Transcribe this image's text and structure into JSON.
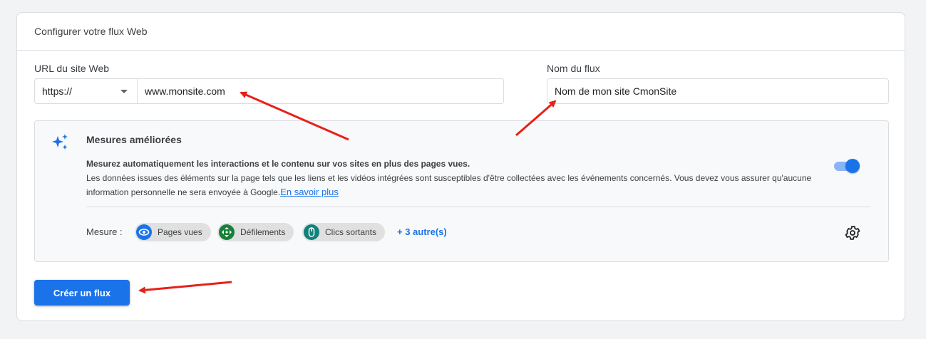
{
  "card": {
    "title": "Configurer votre flux Web"
  },
  "url_section": {
    "label": "URL du site Web",
    "protocol": "https://",
    "url_value": "www.monsite.com"
  },
  "name_section": {
    "label": "Nom du flux",
    "value": "Nom de mon site CmonSite"
  },
  "enhanced": {
    "title": "Mesures améliorées",
    "desc_bold": "Mesurez automatiquement les interactions et le contenu sur vos sites en plus des pages vues.",
    "desc": "Les données issues des éléments sur la page tels que les liens et les vidéos intégrées sont susceptibles d'être collectées avec les événements concernés. Vous devez vous assurer qu'aucune information personnelle ne sera envoyée à Google.",
    "learn_more": "En savoir plus",
    "toggle_on": true,
    "mesure_label": "Mesure :",
    "chips": [
      {
        "label": "Pages vues",
        "icon": "eye-icon"
      },
      {
        "label": "Défilements",
        "icon": "scroll-icon"
      },
      {
        "label": "Clics sortants",
        "icon": "mouse-icon"
      }
    ],
    "more_link": "+ 3 autre(s)"
  },
  "create_button": "Créer un flux",
  "colors": {
    "accent": "#1a73e8",
    "annotation_arrow": "#e8201a"
  }
}
